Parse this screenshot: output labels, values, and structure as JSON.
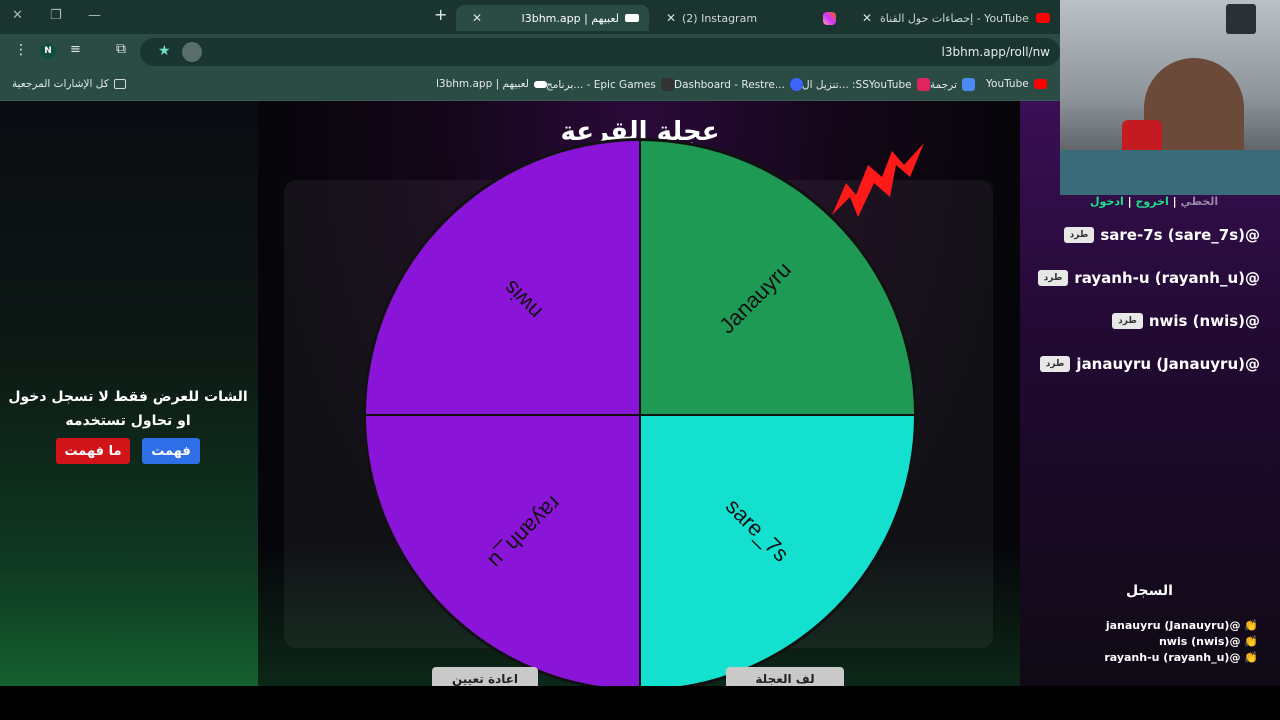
{
  "browser": {
    "tabs": [
      {
        "label": "l3bhm.app | لعبيهم",
        "active": true
      },
      {
        "label": "(2) Instagram",
        "active": false
      },
      {
        "label": "إحصاءات حول القناة - YouTube Studio",
        "active": false
      }
    ],
    "url": "l3bhm.app/roll/nw",
    "profile_initial": "N",
    "bookmarks": [
      {
        "label": "YouTube",
        "color": "#ff0000"
      },
      {
        "label": "ترجمة",
        "color": "#4a8af4"
      },
      {
        "label": "تنزيل ال... :SSYouTube",
        "color": "#e0245e"
      },
      {
        "label": "Dashboard - Restre...",
        "color": "#3d63ff"
      },
      {
        "label": "برنامج... - Epic Games",
        "color": "#333333"
      },
      {
        "label": "l3bhm.app | لعبيهم",
        "color": "#ffffff"
      },
      {
        "label": "كل الإشارات المرجعية",
        "color": "#cfd8d6"
      }
    ]
  },
  "left": {
    "notice": "الشات للعرض فقط لا تسجل دخول او تحاول تستخدمه",
    "understood_btn": "فهمت",
    "not_understood_btn": "ما فهمت"
  },
  "wheel": {
    "title": "عجلة القرعة",
    "segments": [
      {
        "label": "Janauyru",
        "color": "#1f9a55"
      },
      {
        "label": "sare_7s",
        "color": "#14e0cf"
      },
      {
        "label": "rayanh_u",
        "color": "#8a15d8"
      },
      {
        "label": "nwis",
        "color": "#8a15d8"
      }
    ],
    "pointer_color": "#ff1a1a",
    "reset_btn": "اعادة تعيين",
    "spin_btn": "لف العجلة"
  },
  "right": {
    "auth": {
      "login": "ادخول",
      "logout": "اخروج",
      "error": "الخطي"
    },
    "kick_label": "طرد",
    "players": [
      "sare-7s (sare_7s)@",
      "rayanh-u (rayanh_u)@",
      "nwis (nwis)@",
      "janauyru (Janauyru)@"
    ],
    "log_title": "السجل",
    "log": [
      "janauyru (Janauyru)@",
      "nwis (nwis)@",
      "rayanh-u (rayanh_u)@"
    ]
  }
}
